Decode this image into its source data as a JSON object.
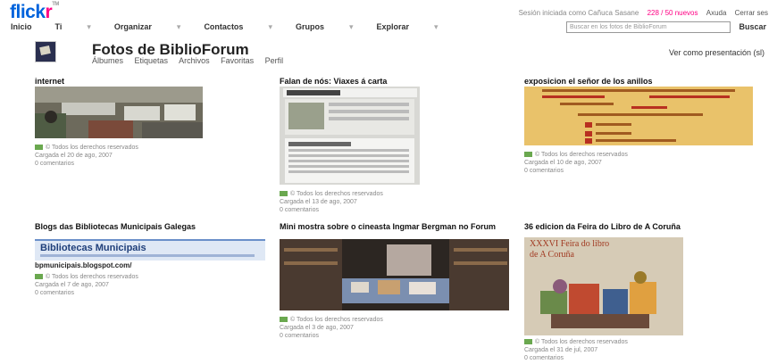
{
  "header": {
    "logo": {
      "part1": "flick",
      "part2": "r",
      "tm": "TM"
    },
    "session": "Sesión iniciada como Cañuca Sasane",
    "messages": "228 / 50 nuevos",
    "help": "Axuda",
    "logout": "Cerrar ses"
  },
  "nav": {
    "items": [
      "Inicio",
      "Ti",
      "Organizar",
      "Contactos",
      "Grupos",
      "Explorar"
    ],
    "search_placeholder": "Buscar en los fotos de BiblioForum",
    "search_button": "Buscar"
  },
  "profile": {
    "title": "Fotos de BiblioForum",
    "tabs": [
      "Álbumes",
      "Etiquetas",
      "Archivos",
      "Favoritas",
      "Perfil"
    ],
    "slideshow": "Ver como presentación (sl)"
  },
  "photos": [
    {
      "title": "internet",
      "rights": "© Todos los derechos reservados",
      "uploaded": "Cargada el 20 de ago, 2007",
      "comments": "0 comentarios"
    },
    {
      "title": "Falan de nós: Viaxes á carta",
      "rights": "© Todos los derechos reservados",
      "uploaded": "Cargada el 13 de ago, 2007",
      "comments": "0 comentarios"
    },
    {
      "title": "exposicion el señor de los anillos",
      "rights": "© Todos los derechos reservados",
      "uploaded": "Cargada el 10 de ago, 2007",
      "comments": "0 comentarios"
    },
    {
      "title": "Blogs das Bibliotecas Municipais Galegas",
      "banner": "Bibliotecas Municipais",
      "url": "bpmunicipais.blogspot.com/",
      "rights": "© Todos los derechos reservados",
      "uploaded": "Cargada el 7 de ago, 2007",
      "comments": "0 comentarios"
    },
    {
      "title": "Mini mostra sobre o cineasta Ingmar Bergman no Forum",
      "rights": "© Todos los derechos reservados",
      "uploaded": "Cargada el 3 de ago, 2007",
      "comments": "0 comentarios"
    },
    {
      "title": "36 edicion da Feira do Libro de A Coruña",
      "poster_line1": "XXXVI Feira do libro",
      "poster_line2": "de A Coruña",
      "rights": "© Todos los derechos reservados",
      "uploaded": "Cargada el 31 de jul, 2007",
      "comments": "0 comentarios"
    }
  ],
  "colors": {
    "brand_blue": "#0063dc",
    "brand_pink": "#ff0084"
  }
}
